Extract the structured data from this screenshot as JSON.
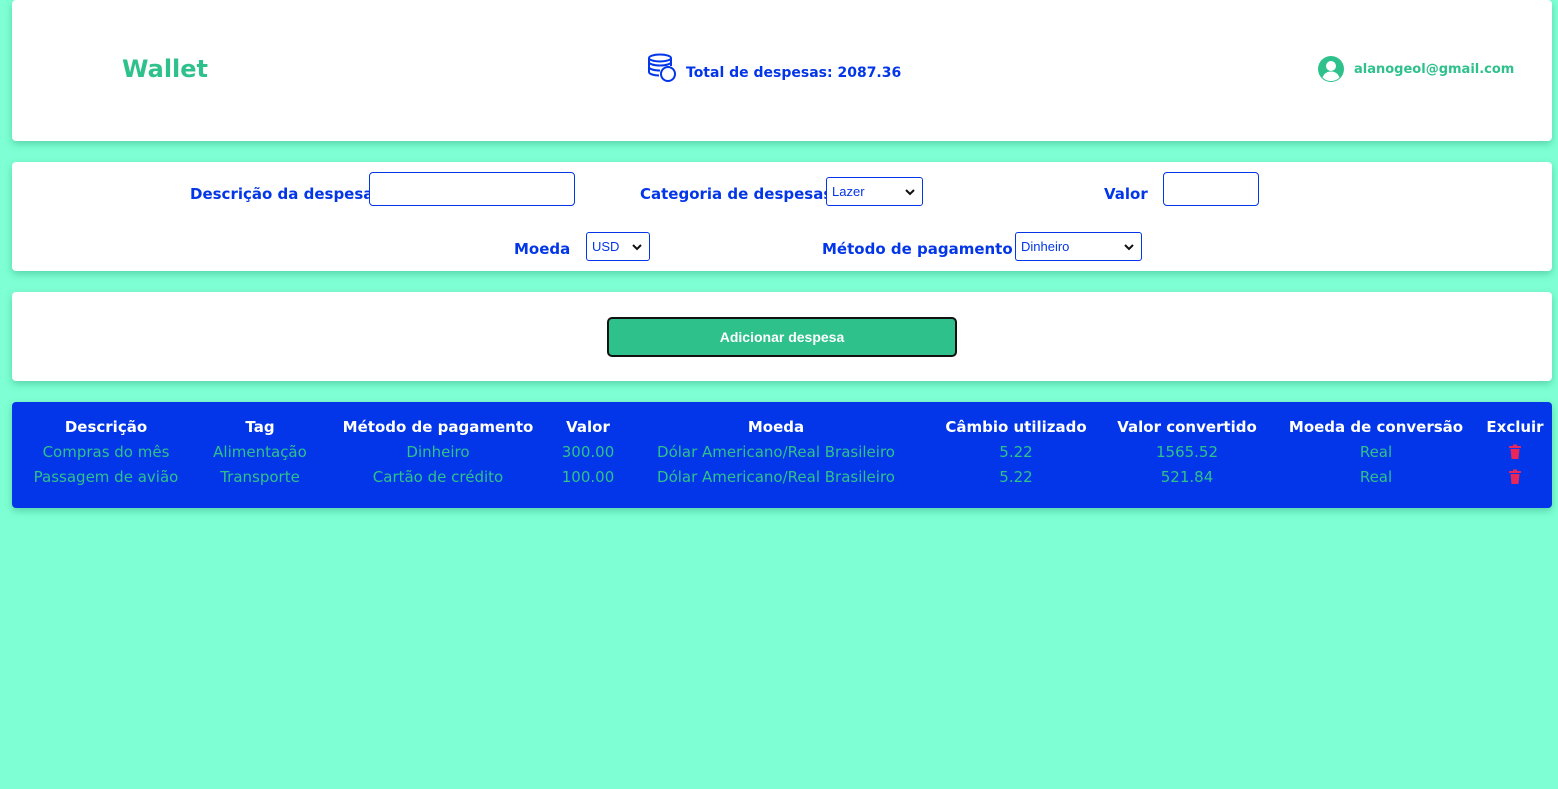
{
  "header": {
    "logo": "Wallet",
    "total_label": "Total de despesas: 2087.36",
    "user_email": "alanogeol@gmail.com"
  },
  "form": {
    "description_label": "Descrição da despesa",
    "description_value": "",
    "category_label": "Categoria de despesas",
    "category_value": "Lazer",
    "value_label": "Valor",
    "value_value": "",
    "currency_label": "Moeda",
    "currency_value": "USD",
    "method_label": "Método de pagamento",
    "method_value": "Dinheiro"
  },
  "add_button_label": "Adicionar despesa",
  "table": {
    "headers": [
      "Descrição",
      "Tag",
      "Método de pagamento",
      "Valor",
      "Moeda",
      "Câmbio utilizado",
      "Valor convertido",
      "Moeda de conversão",
      "Excluir"
    ],
    "rows": [
      [
        "Compras do mês",
        "Alimentação",
        "Dinheiro",
        "300.00",
        "Dólar Americano/Real Brasileiro",
        "5.22",
        "1565.52",
        "Real"
      ],
      [
        "Passagem de avião",
        "Transporte",
        "Cartão de crédito",
        "100.00",
        "Dólar Americano/Real Brasileiro",
        "5.22",
        "521.84",
        "Real"
      ]
    ]
  },
  "icons": {
    "coins": "coins-icon",
    "user": "user-circle-icon",
    "delete": "trash-icon",
    "dropdown": "chevron-down-icon"
  },
  "colors": {
    "background": "#7fffd4",
    "accent_green": "#2fc18c",
    "accent_blue": "#0336e8",
    "delete_red": "#e8265a"
  }
}
